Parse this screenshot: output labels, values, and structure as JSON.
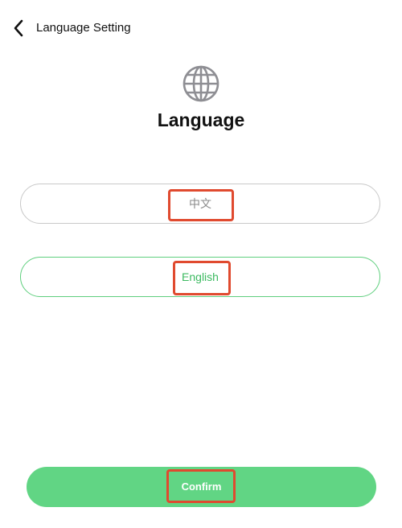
{
  "header": {
    "title": "Language Setting",
    "back_icon": "chevron-left-icon"
  },
  "main": {
    "icon": "globe-icon",
    "title": "Language",
    "options": [
      {
        "label": "中文",
        "selected": false
      },
      {
        "label": "English",
        "selected": true
      }
    ],
    "confirm_label": "Confirm"
  },
  "colors": {
    "accent": "#61d584",
    "selected_text": "#3cba61",
    "selected_border": "#5fcf7e",
    "unselected_border": "#c9c9c9",
    "highlight": "#e04a2f"
  }
}
